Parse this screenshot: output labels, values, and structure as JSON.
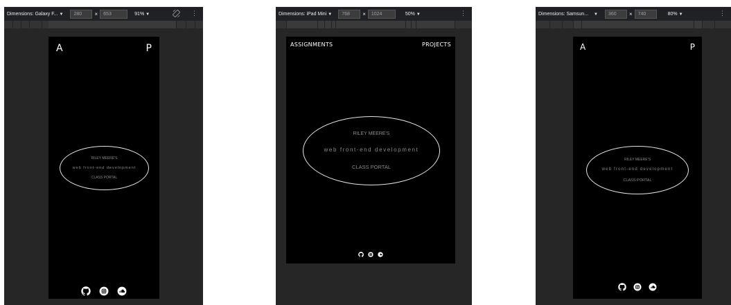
{
  "panels": [
    {
      "toolbar": {
        "device_label": "Dimensions: Galaxy F...",
        "width": "280",
        "height": "653",
        "zoom": "91%",
        "more": "⋮"
      },
      "site": {
        "nav_left": "A",
        "nav_right": "P",
        "top_line": "RILEY MEERE'S",
        "middle_line": "web front-end development",
        "bottom_line": "CLASS PORTAL",
        "socials": [
          "github-icon",
          "instagram-icon",
          "soundcloud-icon"
        ]
      }
    },
    {
      "toolbar": {
        "device_label": "Dimensions: iPad Mini",
        "width": "768",
        "height": "1024",
        "zoom": "50%",
        "more": "⋮"
      },
      "site": {
        "nav_left": "ASSIGNMENTS",
        "nav_right": "PROJECTS",
        "top_line": "RILEY MEERE'S",
        "middle_line": "web front-end development",
        "bottom_line": "CLASS PORTAL",
        "socials": [
          "github-icon",
          "instagram-icon",
          "soundcloud-icon"
        ]
      }
    },
    {
      "toolbar": {
        "device_label": "Dimensions: Samsun...",
        "width": "360",
        "height": "740",
        "zoom": "80%",
        "more": "⋮"
      },
      "site": {
        "nav_left": "A",
        "nav_right": "P",
        "top_line": "RILEY MEERE'S",
        "middle_line": "web front-end development",
        "bottom_line": "CLASS PORTAL",
        "socials": [
          "github-icon",
          "instagram-icon",
          "soundcloud-icon"
        ]
      }
    }
  ],
  "colors": {
    "panel_bg": "#262626",
    "toolbar_bg": "#202124",
    "device_bg": "#000000",
    "text_dim": "#8a8a8a"
  }
}
